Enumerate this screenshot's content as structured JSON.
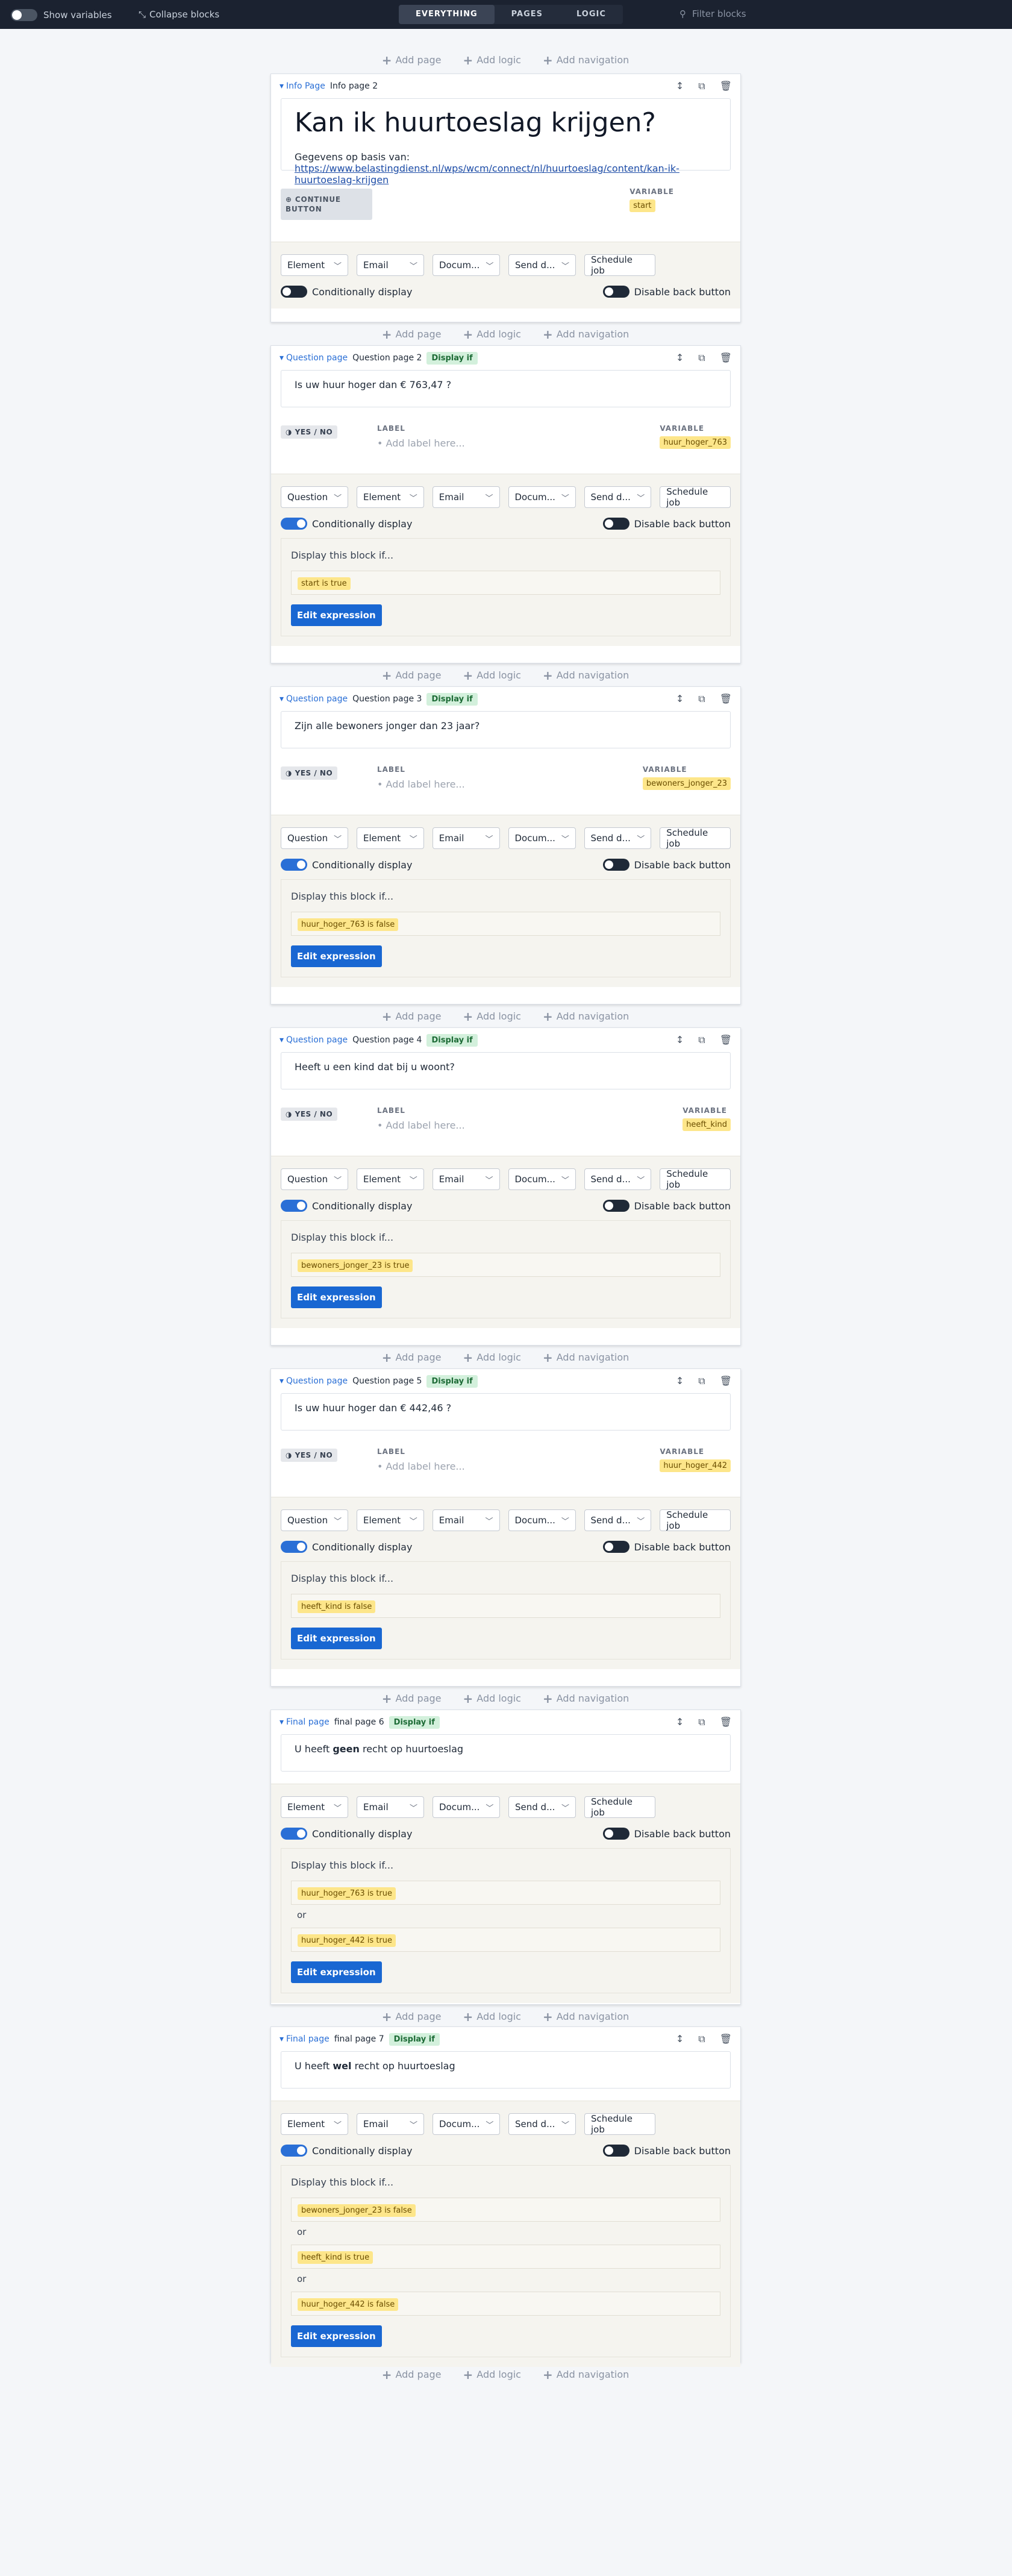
{
  "topbar": {
    "show_variables": "Show variables",
    "collapse_blocks": "Collapse blocks",
    "tabs": [
      "EVERYTHING",
      "PAGES",
      "LOGIC"
    ],
    "filter_placeholder": "Filter blocks"
  },
  "adds": {
    "page": "Add page",
    "logic": "Add logic",
    "navigation": "Add navigation"
  },
  "common": {
    "label_caption": "LABEL",
    "variable_caption": "VARIABLE",
    "label_placeholder": "Add label here...",
    "yes_no": "YES / NO",
    "continue_button": "CONTINUE BUTTON",
    "conditionally_display": "Conditionally display",
    "disable_back": "Disable back button",
    "display_if_badge": "Display if",
    "display_block_if": "Display this block if...",
    "or": "or",
    "edit_expression": "Edit expression",
    "dd_element": "Element",
    "dd_email": "Email",
    "dd_document": "Docum...",
    "dd_send": "Send d...",
    "dd_question": "Question",
    "schedule_job": "Schedule job"
  },
  "blocks": [
    {
      "type": "Info Page",
      "name": "Info page 2",
      "title": "Kan ik huurtoeslag krijgen?",
      "source_prefix": "Gegevens op basis van:",
      "source_link": "https://www.belastingdienst.nl/wps/wcm/connect/nl/huurtoeslag/content/kan-ik-huurtoeslag-krijgen",
      "variable": "start"
    },
    {
      "type": "Question page",
      "name": "Question page 2",
      "question": "Is uw huur hoger dan € 763,47 ?",
      "variable": "huur_hoger_763",
      "conditions": [
        "start is true"
      ]
    },
    {
      "type": "Question page",
      "name": "Question page 3",
      "question": "Zijn alle bewoners jonger dan 23 jaar?",
      "variable": "bewoners_jonger_23",
      "conditions": [
        "huur_hoger_763 is false"
      ]
    },
    {
      "type": "Question page",
      "name": "Question page 4",
      "question": "Heeft u een kind dat bij u woont?",
      "variable": "heeft_kind",
      "conditions": [
        "bewoners_jonger_23 is true"
      ]
    },
    {
      "type": "Question page",
      "name": "Question page 5",
      "question": "Is uw huur hoger dan € 442,46 ?",
      "variable": "huur_hoger_442",
      "conditions": [
        "heeft_kind is false"
      ]
    },
    {
      "type": "Final page",
      "name": "final page 6",
      "text_before": "U heeft",
      "text_bold": "geen",
      "text_after": "recht op huurtoeslag",
      "conditions": [
        "huur_hoger_763 is true",
        "huur_hoger_442 is true"
      ]
    },
    {
      "type": "Final page",
      "name": "final page 7",
      "text_before": "U heeft",
      "text_bold": "wel",
      "text_after": "recht op huurtoeslag",
      "conditions": [
        "bewoners_jonger_23 is false",
        "heeft_kind is true",
        "huur_hoger_442 is false"
      ]
    }
  ]
}
